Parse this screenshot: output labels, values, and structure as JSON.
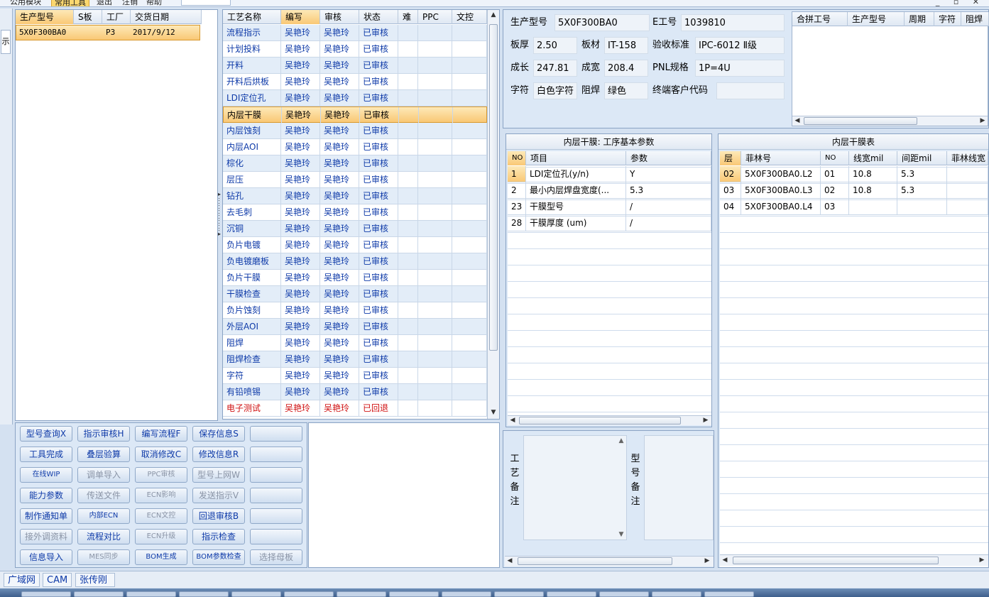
{
  "menu": {
    "items": [
      "公用模块",
      "常用工具",
      "退出",
      "注销",
      "帮助"
    ]
  },
  "left_strip": {
    "label": "示"
  },
  "order_list": {
    "columns": [
      "生产型号",
      "S板",
      "工厂",
      "交货日期"
    ],
    "rows": [
      {
        "model": "5X0F300BA0",
        "s": "",
        "factory": "P3",
        "date": "2017/9/12"
      }
    ]
  },
  "process": {
    "columns": [
      "工艺名称",
      "编写",
      "审核",
      "状态",
      "难",
      "PPC",
      "文控"
    ],
    "rows": [
      {
        "name": "流程指示",
        "author": "吴艳玲",
        "reviewer": "吴艳玲",
        "status": "已审核"
      },
      {
        "name": "计划投料",
        "author": "吴艳玲",
        "reviewer": "吴艳玲",
        "status": "已审核"
      },
      {
        "name": "开料",
        "author": "吴艳玲",
        "reviewer": "吴艳玲",
        "status": "已审核"
      },
      {
        "name": "开料后烘板",
        "author": "吴艳玲",
        "reviewer": "吴艳玲",
        "status": "已审核"
      },
      {
        "name": "LDI定位孔",
        "author": "吴艳玲",
        "reviewer": "吴艳玲",
        "status": "已审核"
      },
      {
        "name": "内层干膜",
        "author": "吴艳玲",
        "reviewer": "吴艳玲",
        "status": "已审核"
      },
      {
        "name": "内层蚀刻",
        "author": "吴艳玲",
        "reviewer": "吴艳玲",
        "status": "已审核"
      },
      {
        "name": "内层AOI",
        "author": "吴艳玲",
        "reviewer": "吴艳玲",
        "status": "已审核"
      },
      {
        "name": "棕化",
        "author": "吴艳玲",
        "reviewer": "吴艳玲",
        "status": "已审核"
      },
      {
        "name": "层压",
        "author": "吴艳玲",
        "reviewer": "吴艳玲",
        "status": "已审核"
      },
      {
        "name": "钻孔",
        "author": "吴艳玲",
        "reviewer": "吴艳玲",
        "status": "已审核"
      },
      {
        "name": "去毛刺",
        "author": "吴艳玲",
        "reviewer": "吴艳玲",
        "status": "已审核"
      },
      {
        "name": "沉铜",
        "author": "吴艳玲",
        "reviewer": "吴艳玲",
        "status": "已审核"
      },
      {
        "name": "负片电镀",
        "author": "吴艳玲",
        "reviewer": "吴艳玲",
        "status": "已审核"
      },
      {
        "name": "负电镀磨板",
        "author": "吴艳玲",
        "reviewer": "吴艳玲",
        "status": "已审核"
      },
      {
        "name": "负片干膜",
        "author": "吴艳玲",
        "reviewer": "吴艳玲",
        "status": "已审核"
      },
      {
        "name": "干膜检查",
        "author": "吴艳玲",
        "reviewer": "吴艳玲",
        "status": "已审核"
      },
      {
        "name": "负片蚀刻",
        "author": "吴艳玲",
        "reviewer": "吴艳玲",
        "status": "已审核"
      },
      {
        "name": "外层AOI",
        "author": "吴艳玲",
        "reviewer": "吴艳玲",
        "status": "已审核"
      },
      {
        "name": "阻焊",
        "author": "吴艳玲",
        "reviewer": "吴艳玲",
        "status": "已审核"
      },
      {
        "name": "阻焊检查",
        "author": "吴艳玲",
        "reviewer": "吴艳玲",
        "status": "已审核"
      },
      {
        "name": "字符",
        "author": "吴艳玲",
        "reviewer": "吴艳玲",
        "status": "已审核"
      },
      {
        "name": "有铅喷锡",
        "author": "吴艳玲",
        "reviewer": "吴艳玲",
        "status": "已审核"
      },
      {
        "name": "电子测试",
        "author": "吴艳玲",
        "reviewer": "吴艳玲",
        "status": "已回退"
      }
    ]
  },
  "buttons": [
    [
      "型号查询X",
      "指示审核H",
      "编写流程F",
      "保存信息S",
      ""
    ],
    [
      "工具完成",
      "叠层验算",
      "取消修改C",
      "修改信息R",
      ""
    ],
    [
      "在线WIP",
      "调单导入",
      "PPC审核",
      "型号上网W",
      ""
    ],
    [
      "能力参数",
      "传送文件",
      "ECN影响",
      "发送指示V",
      ""
    ],
    [
      "制作通知单",
      "内部ECN",
      "ECN文控",
      "回退审核B",
      ""
    ],
    [
      "接外调资料",
      "流程对比",
      "ECN升级",
      "指示检查",
      ""
    ],
    [
      "信息导入",
      "MES同步",
      "BOM生成",
      "BOM参数检查",
      "选择母板"
    ]
  ],
  "info": {
    "model_label": "生产型号",
    "model": "5X0F300BA0",
    "e_label": "E工号",
    "e_no": "1039810",
    "thick_label": "板厚",
    "thick": "2.50",
    "material_label": "板材",
    "material": "IT-158",
    "accept_label": "验收标准",
    "accept": "IPC-6012 Ⅱ级",
    "len_label": "成长",
    "len": "247.81",
    "width_label": "成宽",
    "width": "208.4",
    "pnl_label": "PNL规格",
    "pnl": "1P=4U",
    "char_label": "字符",
    "char": "白色字符",
    "mask_label": "阻焊",
    "mask": "绿色",
    "customer_label": "终端客户代码",
    "customer": ""
  },
  "merge": {
    "columns": [
      "合拼工号",
      "生产型号",
      "周期",
      "字符",
      "阻焊"
    ]
  },
  "params": {
    "title": "内层干膜: 工序基本参数",
    "columns": [
      "NO",
      "项目",
      "参数"
    ],
    "rows": [
      {
        "no": "1",
        "item": "LDI定位孔(y/n)",
        "value": "Y"
      },
      {
        "no": "2",
        "item": "最小内层焊盘宽度(...",
        "value": "5.3"
      },
      {
        "no": "23",
        "item": "干膜型号",
        "value": "/"
      },
      {
        "no": "28",
        "item": "干膜厚度 (um)",
        "value": "/"
      }
    ]
  },
  "film": {
    "title": "内层干膜表",
    "columns": [
      "层",
      "菲林号",
      "NO",
      "线宽mil",
      "间距mil",
      "菲林线宽"
    ],
    "rows": [
      {
        "layer": "02",
        "film": "5X0F300BA0.L2",
        "no": "01",
        "lw": "10.8",
        "sp": "5.3"
      },
      {
        "layer": "03",
        "film": "5X0F300BA0.L3",
        "no": "02",
        "lw": "10.8",
        "sp": "5.3"
      },
      {
        "layer": "04",
        "film": "5X0F300BA0.L4",
        "no": "03",
        "lw": "",
        "sp": ""
      }
    ]
  },
  "remarks": {
    "process_label": [
      "工",
      "艺",
      "备",
      "注"
    ],
    "model_label": [
      "型",
      "号",
      "备",
      "注"
    ]
  },
  "status_bar": {
    "items": [
      "广域网",
      "CAM",
      "张传刚"
    ]
  }
}
